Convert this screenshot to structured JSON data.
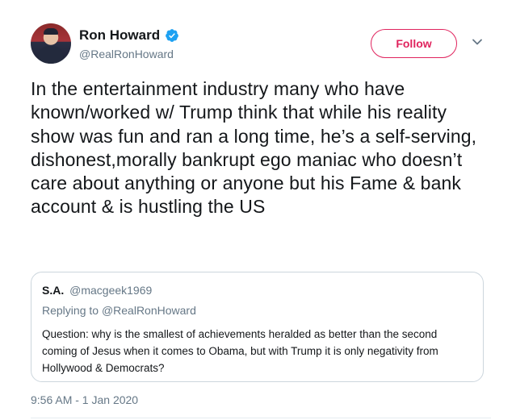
{
  "author": {
    "name": "Ron Howard",
    "handle": "@RealRonHoward",
    "verified": true
  },
  "follow_button": {
    "label": "Follow"
  },
  "tweet": {
    "text": "In the entertainment industry many who have known/worked w/ Trump think that while his reality show was fun and ran a long time, he’s a self-serving, dishonest,morally bankrupt ego maniac who doesn’t care about anything or anyone but his Fame & bank account & is hustling the US",
    "timestamp": "9:56 AM - 1 Jan 2020"
  },
  "quoted_tweet": {
    "name": "S.A.",
    "handle": "@macgeek1969",
    "replying_prefix": "Replying to",
    "replying_to": "@RealRonHoward",
    "text": "Question: why is the smallest of achievements heralded as better than the second coming of Jesus when it comes to Obama, but with Trump it is only negativity from Hollywood & Democrats?"
  },
  "colors": {
    "follow_accent": "#e0245e",
    "verified_blue": "#1da1f2",
    "secondary_text": "#657786",
    "border": "#ccd6dd"
  },
  "icons": {
    "verified": "verified-badge-icon",
    "more": "chevron-down-icon"
  }
}
